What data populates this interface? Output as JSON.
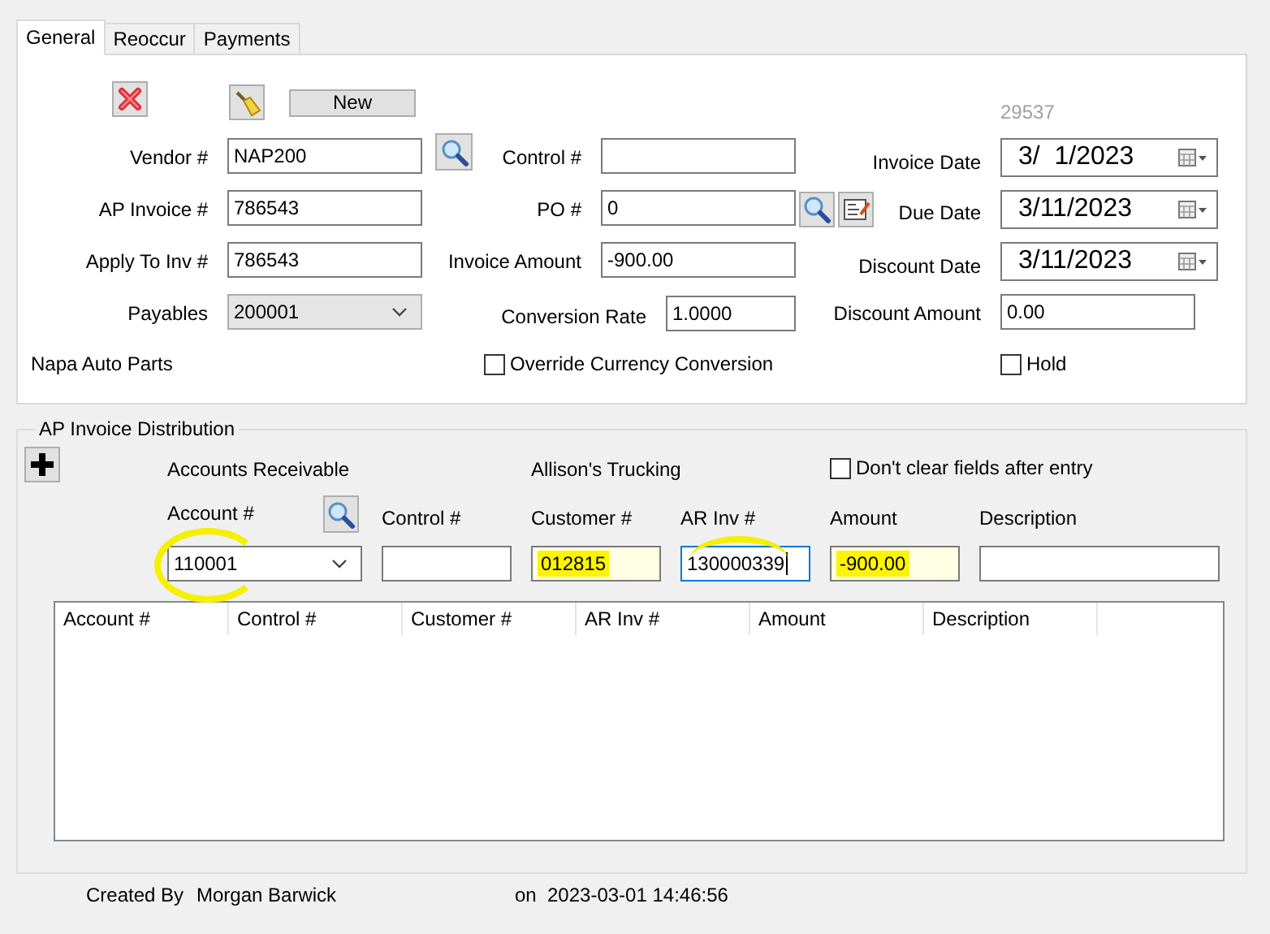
{
  "tabs": [
    {
      "label": "General",
      "selected": true
    },
    {
      "label": "Reoccur",
      "selected": false
    },
    {
      "label": "Payments",
      "selected": false
    }
  ],
  "header": {
    "new_button": "New",
    "record_number": "29537",
    "vendor": {
      "label": "Vendor #",
      "value": "NAP200"
    },
    "ap_invoice": {
      "label": "AP Invoice #",
      "value": "786543"
    },
    "apply_to_inv": {
      "label": "Apply To Inv #",
      "value": "786543"
    },
    "payables": {
      "label": "Payables",
      "value": "200001"
    },
    "control": {
      "label": "Control #"
    },
    "po": {
      "label": "PO #",
      "value": "0"
    },
    "invoice_amount": {
      "label": "Invoice Amount",
      "value": "-900.00"
    },
    "conversion_rate": {
      "label": "Conversion Rate",
      "value": "1.0000"
    },
    "invoice_date": {
      "label": "Invoice Date",
      "value": "3/  1/2023"
    },
    "due_date": {
      "label": "Due Date",
      "value": "3/11/2023"
    },
    "discount_date": {
      "label": "Discount Date",
      "value": "3/11/2023"
    },
    "discount_amount": {
      "label": "Discount Amount",
      "value": "0.00"
    },
    "vendor_name": "Napa Auto Parts",
    "override_currency": {
      "label": "Override Currency Conversion",
      "checked": false
    },
    "hold": {
      "label": "Hold",
      "checked": false
    }
  },
  "distribution": {
    "title": "AP Invoice Distribution",
    "account_name": "Accounts Receivable",
    "customer_name": "Allison's Trucking",
    "dont_clear": {
      "label": "Don't clear fields after entry",
      "checked": false
    },
    "entry_fields": [
      {
        "label": "Account #",
        "value": "110001",
        "kind": "select",
        "focused": false,
        "highlight": {
          "kind": "circle"
        }
      },
      {
        "label": "Control #",
        "kind": "text",
        "focused": false
      },
      {
        "label": "Customer #",
        "value": "012815",
        "kind": "text",
        "focused": false,
        "highlight": {
          "kind": "fill"
        }
      },
      {
        "label": "AR Inv #",
        "value": "130000339",
        "kind": "text",
        "focused": true,
        "highlight": {
          "kind": "arc"
        }
      },
      {
        "label": "Amount",
        "value": "-900.00",
        "kind": "text",
        "focused": false,
        "highlight": {
          "kind": "fill"
        }
      },
      {
        "label": "Description",
        "kind": "text",
        "focused": false
      }
    ],
    "table": {
      "columns": [
        "Account #",
        "Control #",
        "Customer #",
        "AR Inv #",
        "Amount",
        "Description"
      ]
    }
  },
  "footer": {
    "created_by_label": "Created By",
    "created_by": "Morgan Barwick",
    "on_label": "on",
    "created_at": "2023-03-01 14:46:56"
  }
}
